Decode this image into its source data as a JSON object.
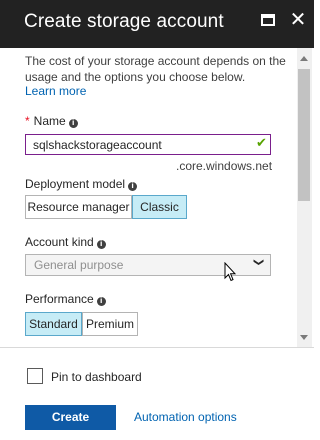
{
  "header": {
    "title": "Create storage account",
    "maximize_icon": "maximize-icon",
    "close_icon": "close-icon",
    "close_glyph": "✕"
  },
  "intro": {
    "description": "The cost of your storage account depends on the usage and the options you choose below.",
    "learn_more": "Learn more"
  },
  "name_field": {
    "required_mark": "*",
    "label": "Name",
    "value": "sqlshackstorageaccount",
    "suffix": ".core.windows.net",
    "valid_icon": "checkmark-icon",
    "check_glyph": "✔"
  },
  "deployment_model": {
    "label": "Deployment model",
    "options": [
      "Resource manager",
      "Classic"
    ],
    "selected": "Classic"
  },
  "account_kind": {
    "label": "Account kind",
    "value": "General purpose",
    "chevron_glyph": "❯"
  },
  "performance": {
    "label": "Performance",
    "options": [
      "Standard",
      "Premium"
    ],
    "selected": "Standard"
  },
  "info_glyph": "i",
  "footer": {
    "pin_label": "Pin to dashboard",
    "pin_checked": false,
    "create_label": "Create",
    "automation_label": "Automation options"
  },
  "colors": {
    "titlebar": "#222222",
    "accent": "#0f5aa6",
    "link": "#0063b1",
    "selected_toggle": "#c6ecf6",
    "valid_check": "#57a300",
    "required": "#e81123"
  }
}
